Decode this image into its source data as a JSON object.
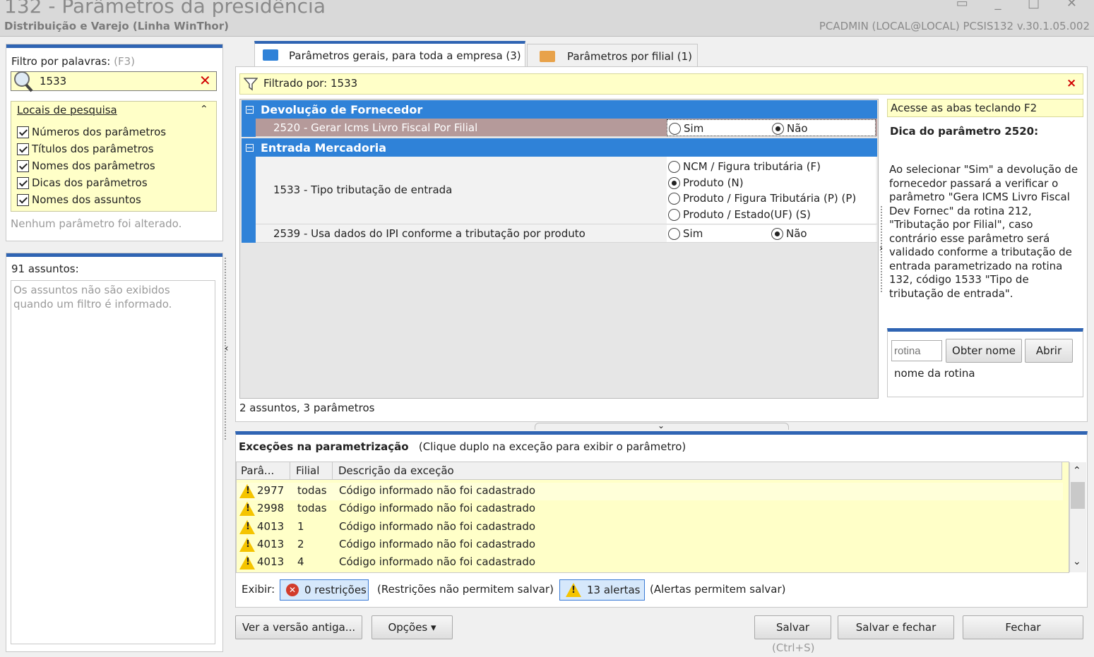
{
  "window": {
    "title": "132 - Parâmetros da presidência",
    "subtitle": "Distribuição e Varejo (Linha WinThor)",
    "user_info": "PCADMIN (LOCAL@LOCAL)   PCSIS132  v.30.1.05.002",
    "controls": "▭ _ □ ✕"
  },
  "filter": {
    "label": "Filtro por palavras:",
    "shortcut": "(F3)",
    "value": "1533",
    "locais_title": "Locais de pesquisa",
    "options": [
      "Números dos parâmetros",
      "Títulos dos parâmetros",
      "Nomes dos parâmetros",
      "Dicas dos parâmetros",
      "Nomes dos assuntos"
    ],
    "no_change": "Nenhum parâmetro foi alterado."
  },
  "assuntos": {
    "label": "91 assuntos:",
    "note": "Os assuntos não são exibidos quando um filtro é informado."
  },
  "tabs": [
    {
      "label": "Parâmetros gerais, para toda a empresa  (3)"
    },
    {
      "label": "Parâmetros por filial  (1)"
    }
  ],
  "filtered": {
    "text": "Filtrado por: 1533",
    "close": "×"
  },
  "groups": [
    {
      "title": "Devolução de Fornecedor",
      "params": [
        {
          "text": "2520 - Gerar Icms Livro Fiscal Por Filial",
          "options": [
            "Sim",
            "Não"
          ],
          "selected": 1
        }
      ]
    },
    {
      "title": "Entrada Mercadoria",
      "params": [
        {
          "text": "1533 - Tipo tributação de entrada",
          "options": [
            "NCM / Figura tributária (F)",
            "Produto (N)",
            "Produto / Figura Tributária (P) (P)",
            "Produto / Estado(UF) (S)"
          ],
          "selected": 1
        },
        {
          "text": "2539 - Usa dados do IPI conforme a tributação por produto",
          "options": [
            "Sim",
            "Não"
          ],
          "selected": 1
        }
      ]
    }
  ],
  "grid_footer": "2 assuntos, 3 parâmetros",
  "tip": {
    "header": "Acesse as abas teclando F2",
    "title": "Dica do parâmetro 2520:",
    "body": "Ao selecionar \"Sim\" a devolução de fornecedor passará a verificar o parâmetro \"Gera ICMS Livro Fiscal Dev Fornec\" da rotina 212, \"Tributação por Filial\", caso contrário esse parâmetro será validado conforme a tributação de entrada parametrizado na rotina 132, código 1533 \"Tipo de tributação de entrada\"."
  },
  "rotina": {
    "placeholder": "rotina",
    "obter_label": "Obter nome",
    "abrir_label": "Abrir",
    "name_label": "nome da rotina"
  },
  "exceptions": {
    "title": "Exceções na parametrização",
    "hint": "(Clique duplo na exceção para exibir o parâmetro)",
    "columns": [
      "Parâ...",
      "Filial",
      "Descrição da exceção"
    ],
    "rows": [
      {
        "param": "2977",
        "filial": "todas",
        "desc": "Código informado não foi cadastrado"
      },
      {
        "param": "2998",
        "filial": "todas",
        "desc": "Código informado não foi cadastrado"
      },
      {
        "param": "4013",
        "filial": "1",
        "desc": "Código informado não foi cadastrado"
      },
      {
        "param": "4013",
        "filial": "2",
        "desc": "Código informado não foi cadastrado"
      },
      {
        "param": "4013",
        "filial": "4",
        "desc": "Código informado não foi cadastrado"
      }
    ],
    "exibir_label": "Exibir:",
    "restr_label": "0 restrições",
    "restr_note": "(Restrições não permitem salvar)",
    "alert_label": "13 alertas",
    "alert_note": "(Alertas permitem salvar)"
  },
  "buttons": {
    "ver": "Ver a versão antiga...",
    "opcoes": "Opções ▾",
    "salvar": "Salvar",
    "salvar_hint": "(Ctrl+S)",
    "salvar_fechar": "Salvar e fechar",
    "fechar": "Fechar"
  },
  "colors": {
    "accent": "#2f64b3",
    "group": "#2f82d8",
    "highlight": "#ffffc8",
    "danger": "#d10000",
    "warning": "#f5c400"
  }
}
